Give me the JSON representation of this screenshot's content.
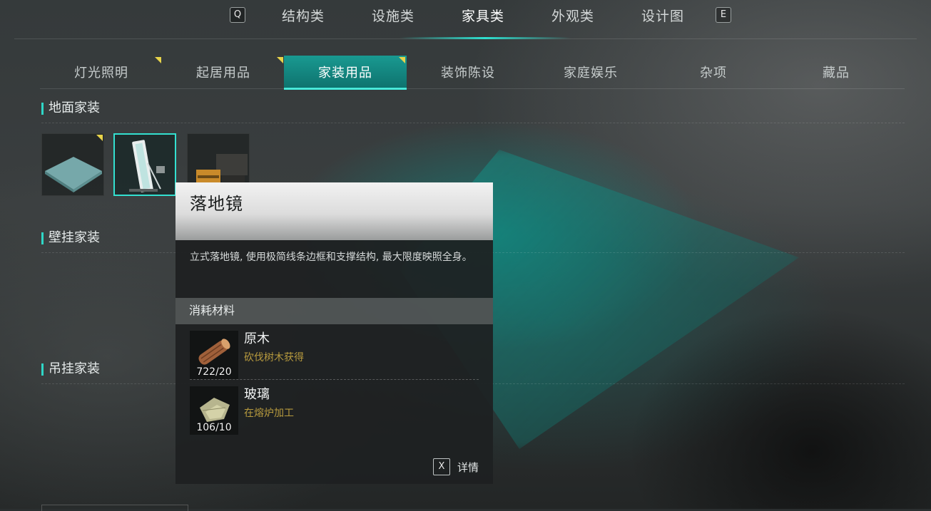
{
  "top_nav": {
    "prev_key": "Q",
    "next_key": "E",
    "items": [
      "结构类",
      "设施类",
      "家具类",
      "外观类",
      "设计图"
    ],
    "active_index": 2
  },
  "sub_tabs": {
    "items": [
      {
        "label": "灯光照明",
        "has_new": true
      },
      {
        "label": "起居用品",
        "has_new": true
      },
      {
        "label": "家装用品",
        "has_new": true
      },
      {
        "label": "装饰陈设",
        "has_new": false
      },
      {
        "label": "家庭娱乐",
        "has_new": false
      },
      {
        "label": "杂项",
        "has_new": false
      },
      {
        "label": "藏品",
        "has_new": false
      }
    ],
    "active_index": 2
  },
  "sections": {
    "floor": {
      "title": "地面家装"
    },
    "wall": {
      "title": "壁挂家装"
    },
    "hanging": {
      "title": "吊挂家装"
    }
  },
  "floor_items": [
    {
      "icon": "floor-mat-icon",
      "has_new": true,
      "selected": false
    },
    {
      "icon": "floor-mirror-icon",
      "has_new": false,
      "selected": true
    },
    {
      "icon": "cabinet-icon",
      "has_new": false,
      "selected": false
    }
  ],
  "tooltip": {
    "title": "落地镜",
    "description": "立式落地镜, 使用极简线条边框和支撑结构, 最大限度映照全身。",
    "cost_label": "消耗材料",
    "materials": [
      {
        "name": "原木",
        "source": "砍伐树木获得",
        "count": "722/20",
        "icon": "log-icon"
      },
      {
        "name": "玻璃",
        "source": "在熔炉加工",
        "count": "106/10",
        "icon": "glass-icon"
      }
    ],
    "details_key": "X",
    "details_label": "详情"
  },
  "colors": {
    "accent": "#2fe0d0",
    "new_marker": "#e8d44a",
    "material_source": "#b79a3e"
  }
}
